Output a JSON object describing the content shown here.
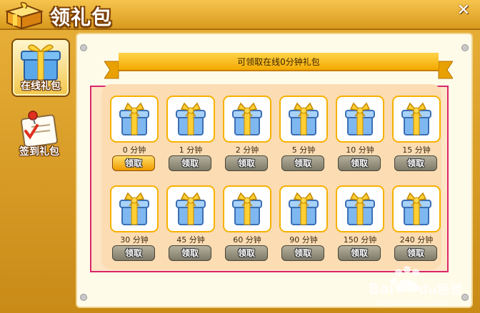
{
  "window": {
    "title": "领礼包",
    "close_glyph": "✕"
  },
  "sidebar": {
    "items": [
      {
        "label": "在线礼包",
        "icon": "gift-box-icon",
        "active": true
      },
      {
        "label": "签到礼包",
        "icon": "checklist-pin-icon",
        "active": false
      }
    ]
  },
  "banner": {
    "text": "可领取在线0分钟礼包"
  },
  "gifts": [
    {
      "time_label": "0 分钟",
      "button": "领取",
      "available": true
    },
    {
      "time_label": "1 分钟",
      "button": "领取",
      "available": false
    },
    {
      "time_label": "2 分钟",
      "button": "领取",
      "available": false
    },
    {
      "time_label": "5 分钟",
      "button": "领取",
      "available": false
    },
    {
      "time_label": "10 分钟",
      "button": "领取",
      "available": false
    },
    {
      "time_label": "15 分钟",
      "button": "领取",
      "available": false
    },
    {
      "time_label": "30 分钟",
      "button": "领取",
      "available": false
    },
    {
      "time_label": "45 分钟",
      "button": "领取",
      "available": false
    },
    {
      "time_label": "60 分钟",
      "button": "领取",
      "available": false
    },
    {
      "time_label": "90 分钟",
      "button": "领取",
      "available": false
    },
    {
      "time_label": "150 分钟",
      "button": "领取",
      "available": false
    },
    {
      "time_label": "240 分钟",
      "button": "领取",
      "available": false
    }
  ],
  "watermark": {
    "brand": "Baidu经验",
    "url": "jingyan.baidu.com"
  }
}
